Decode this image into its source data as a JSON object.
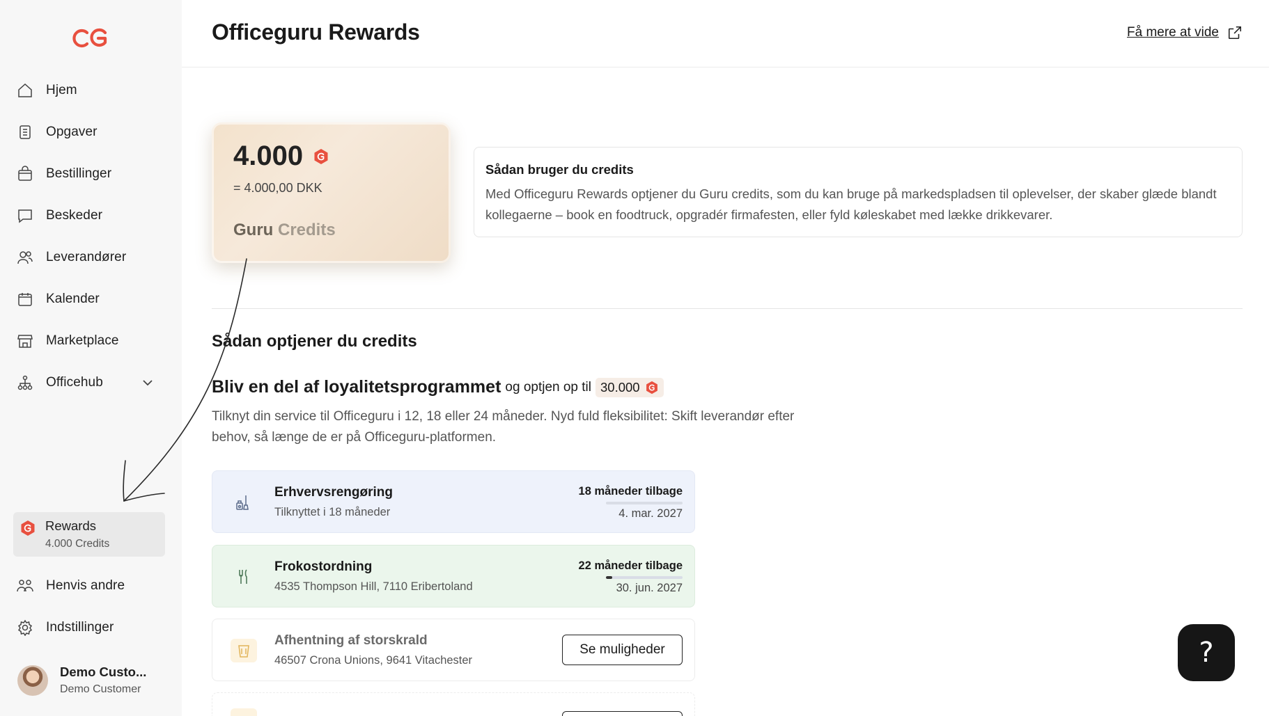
{
  "header": {
    "title": "Officeguru Rewards",
    "learn_more": "Få mere at vide"
  },
  "sidebar": {
    "items": [
      {
        "label": "Hjem",
        "icon": "home-icon"
      },
      {
        "label": "Opgaver",
        "icon": "clipboard-icon"
      },
      {
        "label": "Bestillinger",
        "icon": "shopping-bag-icon"
      },
      {
        "label": "Beskeder",
        "icon": "chat-icon"
      },
      {
        "label": "Leverandører",
        "icon": "users-icon"
      },
      {
        "label": "Kalender",
        "icon": "calendar-icon"
      },
      {
        "label": "Marketplace",
        "icon": "store-icon"
      },
      {
        "label": "Officehub",
        "icon": "hierarchy-icon"
      },
      {
        "label": "Henvis andre",
        "icon": "referral-icon"
      },
      {
        "label": "Indstillinger",
        "icon": "gear-icon"
      }
    ],
    "rewards": {
      "title": "Rewards",
      "credits": "4.000 Credits"
    },
    "user": {
      "name": "Demo Custo...",
      "role": "Demo Customer"
    }
  },
  "credits_card": {
    "amount": "4.000",
    "dkk": "= 4.000,00 DKK",
    "label_main": "Guru",
    "label_faded": "Credits"
  },
  "info": {
    "title": "Sådan bruger du credits",
    "description": "Med Officeguru Rewards optjener du Guru credits, som du kan bruge på markedspladsen til oplevelser, der skaber glæde blandt kollegaerne – book en foodtruck, opgradér firmafesten, eller fyld køleskabet med lække drikkevarer."
  },
  "earn": {
    "section_title": "Sådan optjener du credits",
    "loyalty_title": "Bliv en del af loyalitetsprogrammet",
    "loyalty_mid": "og optjen op til",
    "loyalty_amount": "30.000",
    "loyalty_desc": "Tilknyt din service til Officeguru i 12, 18 eller 24 måneder. Nyd fuld fleksibilitet: Skift leverandør efter behov, så længe de er på Officeguru-platformen."
  },
  "services": [
    {
      "name": "Erhvervsrengøring",
      "sub": "Tilknyttet i 18 måneder",
      "remaining": "18 måneder tilbage",
      "date": "4. mar. 2027",
      "progress": 0.0,
      "icon": "cleaning-icon"
    },
    {
      "name": "Frokostordning",
      "sub": "4535 Thompson Hill, 7110 Eribertoland",
      "remaining": "22 måneder tilbage",
      "date": "30. jun. 2027",
      "progress": 0.08,
      "icon": "cutlery-icon"
    },
    {
      "name": "Afhentning af storskrald",
      "sub": "46507 Crona Unions, 9641 Vitachester",
      "button": "Se muligheder",
      "icon": "bin-icon"
    }
  ],
  "colors": {
    "brand_red": "#e8503f",
    "sidebar_bg": "#f7f7f7"
  }
}
